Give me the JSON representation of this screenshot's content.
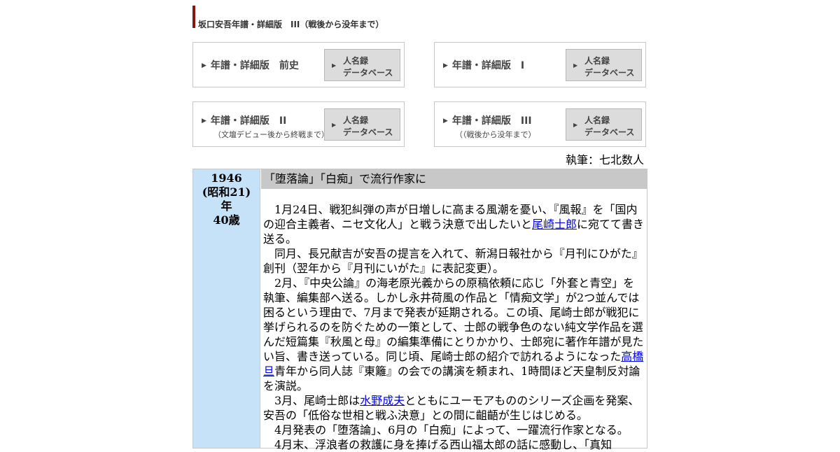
{
  "page_title": "坂口安吾年譜・詳細版　III（戦後から没年まで）",
  "nav": {
    "box1": {
      "label": "年譜・詳細版　前史",
      "db_line1": "人名録",
      "db_line2": "データベース"
    },
    "box2": {
      "label": "年譜・詳細版　I",
      "db_line1": "人名録",
      "db_line2": "データベース"
    },
    "box3": {
      "label": "年譜・詳細版　II",
      "sub": "（文壇デビュー後から終戦まで）",
      "db_line1": "人名録",
      "db_line2": "データベース"
    },
    "box4": {
      "label": "年譜・詳細版　III",
      "sub": "（（戦後から没年まで）",
      "db_line1": "人名録",
      "db_line2": "データベース"
    }
  },
  "author": "執筆：七北数人",
  "entry": {
    "year": "1946",
    "era": "(昭和21)",
    "year_suffix": "年",
    "age": "40歳",
    "heading": "「堕落論」「白痴」で流行作家に",
    "p1_a": "1月24日、戦犯糾弾の声が日増しに高まる風潮を憂い、『風報』を「国内の迎合主義者、ニセ文化人」と戦う決意で出したいと",
    "p1_link": "尾崎士郎",
    "p1_b": "に宛てて書き送る。",
    "p2": "同月、長兄献吉が安吾の提言を入れて、新潟日報社から『月刊にひがた』創刊（翌年から『月刊にいがた』に表記変更）。",
    "p3_a": "2月、『中央公論』の海老原光義からの原稿依頼に応じ「外套と青空」を執筆、編集部へ送る。しかし永井荷風の作品と「情痴文学」が2つ並んでは困るという理由で、7月まで発表が延期される。この頃、尾崎士郎が戦犯に挙げられるのを防ぐための一策として、士郎の戦争色のない純文学作品を選んだ短篇集『秋風と母』の編集準備にとりかかり、士郎宛に著作年譜が見たい旨、書き送っている。同じ頃、尾崎士郎の紹介で訪れるようになった",
    "p3_link": "高橋旦",
    "p3_b": "青年から同人誌『東籬』の会での講演を頼まれ、1時間ほど天皇制反対論を演説。",
    "p4_a": "3月、尾崎士郎は",
    "p4_link": "水野成夫",
    "p4_b": "とともにユーモアもののシリーズ企画を発案、安吾の「低俗な世相と戦ふ決意」との間に齟齬が生じはじめる。",
    "p5": "4月発表の「堕落論」、6月の「白痴」によって、一躍流行作家となる。",
    "p6": "4月末、浮浪者の救護に身を捧げる西山福太郎の話に感動し、「真知"
  }
}
